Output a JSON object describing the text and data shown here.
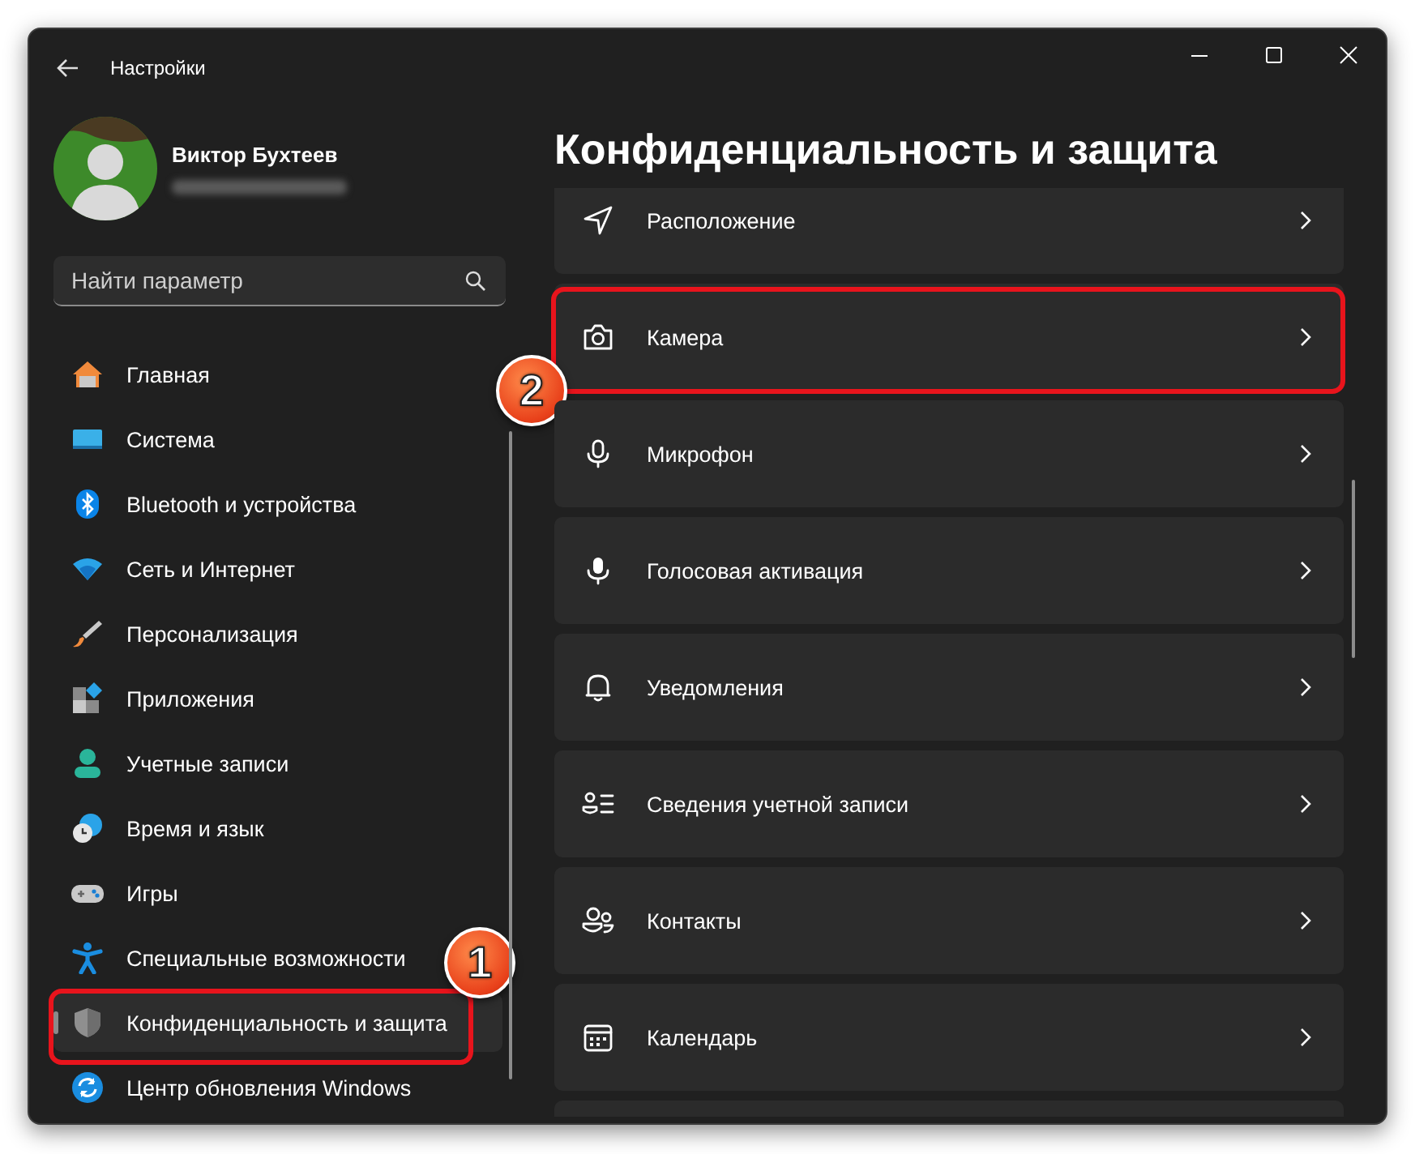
{
  "window": {
    "title": "Настройки"
  },
  "account": {
    "name": "Виктор Бухтеев"
  },
  "search": {
    "placeholder": "Найти параметр"
  },
  "sidebar": {
    "items": [
      {
        "label": "Главная",
        "kind": "home",
        "selected": false
      },
      {
        "label": "Система",
        "kind": "system",
        "selected": false
      },
      {
        "label": "Bluetooth и устройства",
        "kind": "bluetooth",
        "selected": false
      },
      {
        "label": "Сеть и Интернет",
        "kind": "wifi",
        "selected": false
      },
      {
        "label": "Персонализация",
        "kind": "brush",
        "selected": false
      },
      {
        "label": "Приложения",
        "kind": "apps",
        "selected": false
      },
      {
        "label": "Учетные записи",
        "kind": "person",
        "selected": false
      },
      {
        "label": "Время и язык",
        "kind": "clock",
        "selected": false
      },
      {
        "label": "Игры",
        "kind": "gamepad",
        "selected": false
      },
      {
        "label": "Специальные возможности",
        "kind": "accessibility",
        "selected": false
      },
      {
        "label": "Конфиденциальность и защита",
        "kind": "shield",
        "selected": true,
        "callout": "1"
      },
      {
        "label": "Центр обновления Windows",
        "kind": "update",
        "selected": false
      }
    ]
  },
  "page": {
    "title": "Конфиденциальность и защита",
    "cards": [
      {
        "label": "Расположение",
        "kind": "location"
      },
      {
        "label": "Камера",
        "kind": "camera",
        "callout": "2"
      },
      {
        "label": "Микрофон",
        "kind": "mic"
      },
      {
        "label": "Голосовая активация",
        "kind": "voice"
      },
      {
        "label": "Уведомления",
        "kind": "bell"
      },
      {
        "label": "Сведения учетной записи",
        "kind": "accountinfo"
      },
      {
        "label": "Контакты",
        "kind": "contacts"
      },
      {
        "label": "Календарь",
        "kind": "calendar"
      },
      {
        "kind": "blank"
      }
    ]
  }
}
